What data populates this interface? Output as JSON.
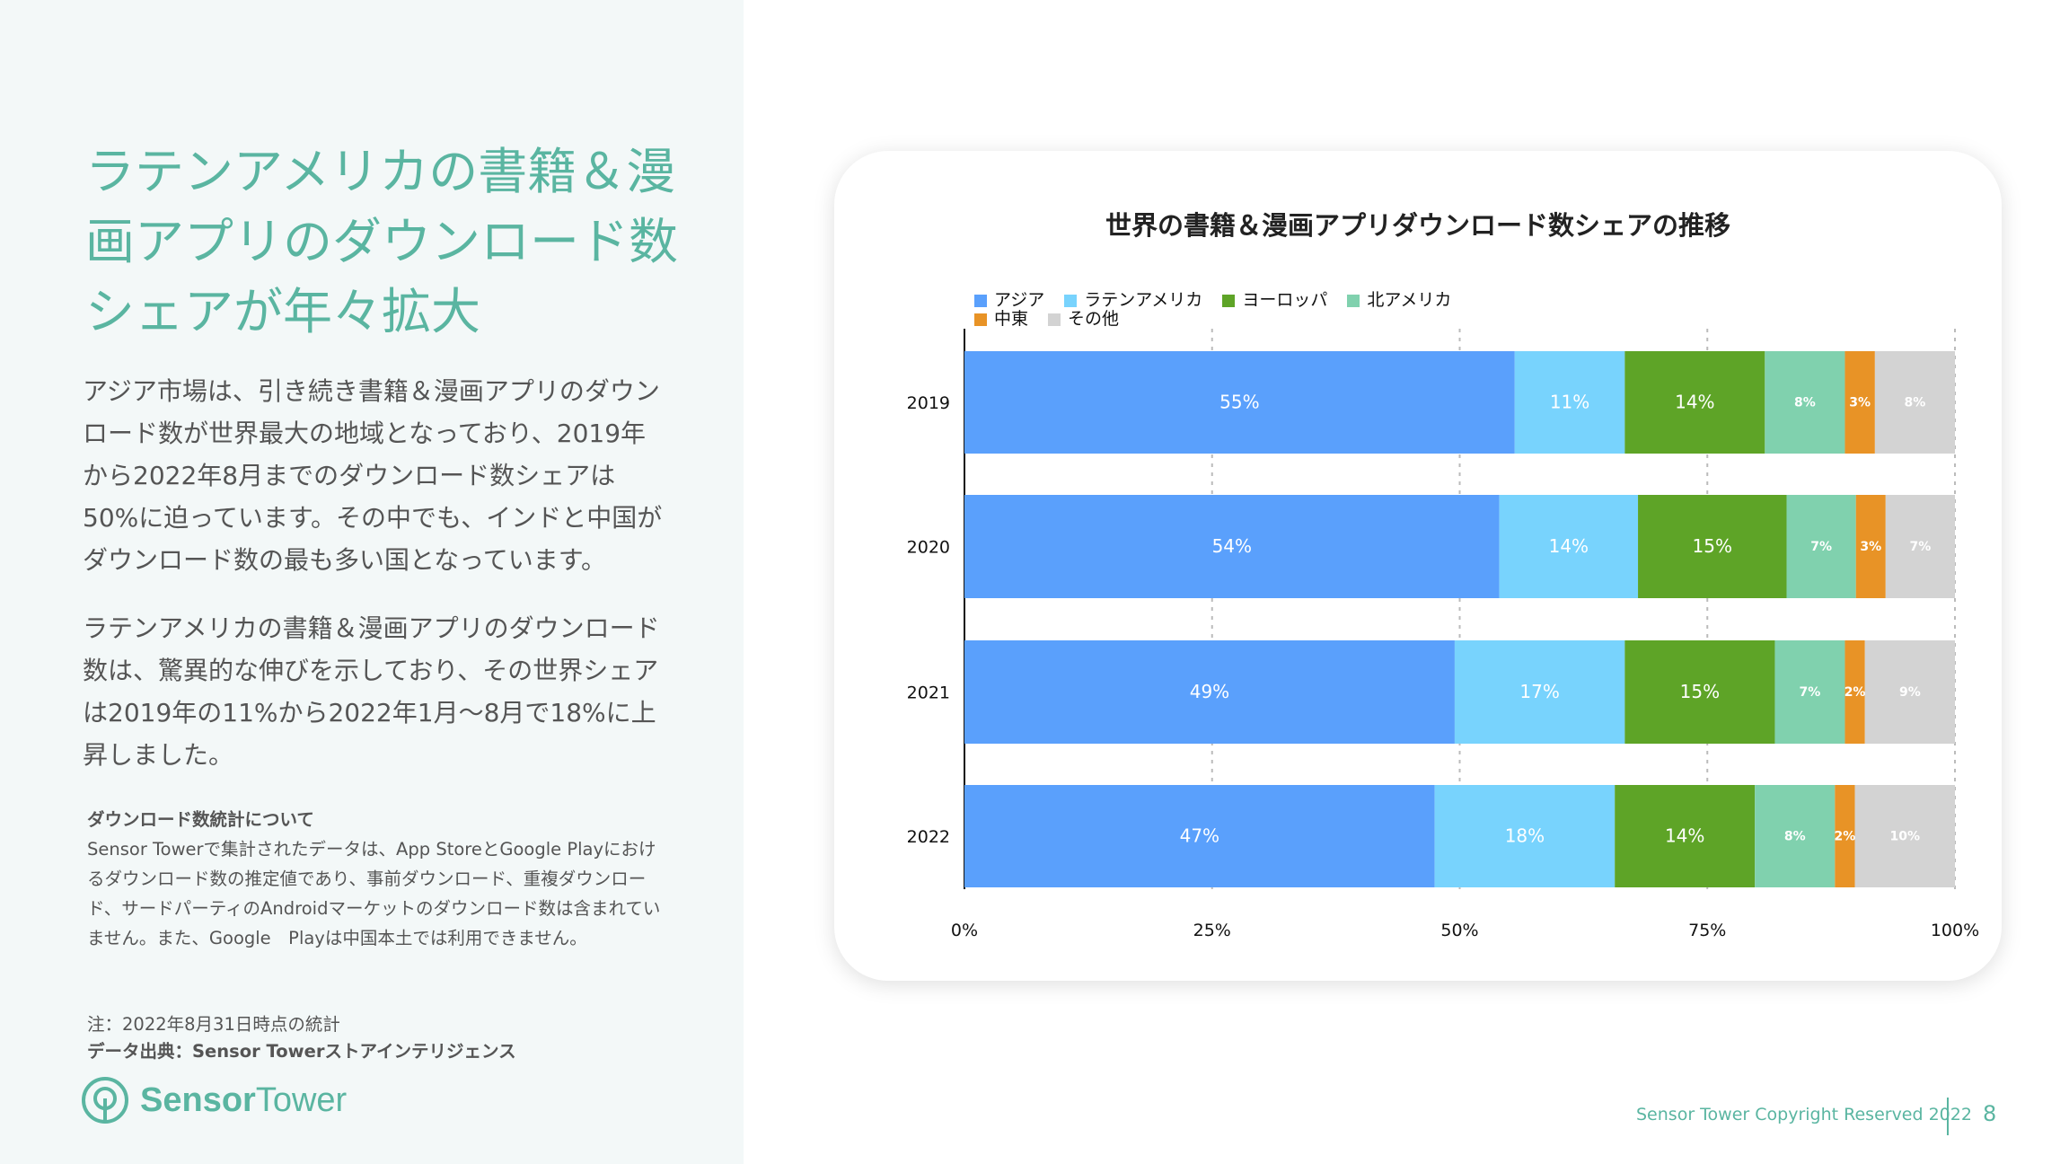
{
  "left": {
    "title": "ラテンアメリカの書籍＆漫画アプリのダウンロード数シェアが年々拡大",
    "body1": "アジア市場は、引き続き書籍＆漫画アプリのダウンロード数が世界最大の地域となっており、2019年から2022年8月までのダウンロード数シェアは50%に迫っています。その中でも、インドと中国がダウンロード数の最も多い国となっています。",
    "body2": "ラテンアメリカの書籍＆漫画アプリのダウンロード数は、驚異的な伸びを示しており、その世界シェアは2019年の11%から2022年1月〜8月で18%に上昇しました。",
    "notes_heading": "ダウンロード数統計について",
    "notes_text": "Sensor Towerで集計されたデータは、App StoreとGoogle Playにおけるダウンロード数の推定値であり、事前ダウンロード、重複ダウンロード、サードパーティのAndroidマーケットのダウンロード数は含まれていません。また、Google　Playは中国本土では利用できません。",
    "note": "注：2022年8月31日時点の統計",
    "source": "データ出典：Sensor Towerストアインテリジェンス",
    "logo": "Sensor Tower"
  },
  "footer": {
    "copyright": "Sensor Tower Copyright Reserved 2022",
    "page": "8"
  },
  "chart_data": {
    "type": "bar",
    "orientation": "horizontal-stacked-100",
    "title": "世界の書籍＆漫画アプリダウンロード数シェアの推移",
    "categories": [
      "2019",
      "2020",
      "2021",
      "2022"
    ],
    "xlim": [
      0,
      100
    ],
    "xticks": [
      "0%",
      "25%",
      "50%",
      "75%",
      "100%"
    ],
    "grid": "vertical dashed",
    "legend": "top-left",
    "series": [
      {
        "name": "アジア",
        "color": "#5aa0fc",
        "label_color": "#ffffff",
        "values": [
          55,
          54,
          49,
          47
        ]
      },
      {
        "name": "ラテンアメリカ",
        "color": "#78d3fd",
        "label_color": "#ffffff",
        "values": [
          11,
          14,
          17,
          18
        ]
      },
      {
        "name": "ヨーロッパ",
        "color": "#5ea427",
        "label_color": "#ffffff",
        "values": [
          14,
          15,
          15,
          14
        ]
      },
      {
        "name": "北アメリカ",
        "color": "#80d1ae",
        "label_color": "#ffffff",
        "values": [
          8,
          7,
          7,
          8
        ]
      },
      {
        "name": "中東",
        "color": "#e89326",
        "label_color": "#ffffff",
        "values": [
          3,
          3,
          2,
          2
        ]
      },
      {
        "name": "その他",
        "color": "#d3d3d3",
        "label_color": "#ffffff",
        "values": [
          8,
          7,
          9,
          10
        ]
      }
    ]
  }
}
